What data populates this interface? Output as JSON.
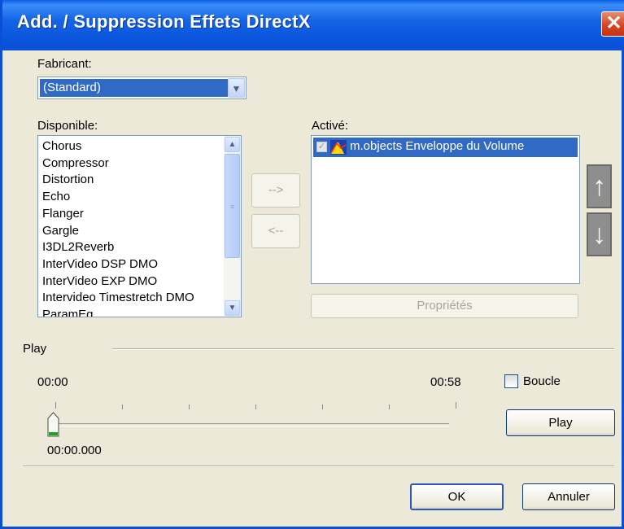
{
  "window": {
    "title": "Add. / Suppression Effets DirectX",
    "close_glyph": "✕"
  },
  "manufacturer": {
    "label": "Fabricant:",
    "value": "(Standard)"
  },
  "available": {
    "label": "Disponible:",
    "items": [
      "Chorus",
      "Compressor",
      "Distortion",
      "Echo",
      "Flanger",
      "Gargle",
      "I3DL2Reverb",
      "InterVideo DSP DMO",
      "InterVideo EXP DMO",
      "Intervideo Timestretch DMO",
      "ParamEq"
    ]
  },
  "transfer": {
    "add_label": "-->",
    "remove_label": "<--"
  },
  "active": {
    "label": "Activé:",
    "items": [
      {
        "label": "m.objects Enveloppe du Volume",
        "checked": true,
        "selected": true
      }
    ]
  },
  "order": {
    "up_icon": "arrow-up-icon",
    "down_icon": "arrow-down-icon"
  },
  "properties_button": "Propriétés",
  "play": {
    "section_label": "Play",
    "start_time": "00:00",
    "end_time": "00:58",
    "position": "00:00.000",
    "position_fraction": 0,
    "loop_label": "Boucle",
    "loop_checked": false,
    "play_button": "Play"
  },
  "footer": {
    "ok_label": "OK",
    "cancel_label": "Annuler"
  },
  "colors": {
    "title_bar": "#0b4fd6",
    "selection": "#316ac5",
    "dialog_bg": "#ece9d8",
    "close_button": "#d5421f"
  }
}
